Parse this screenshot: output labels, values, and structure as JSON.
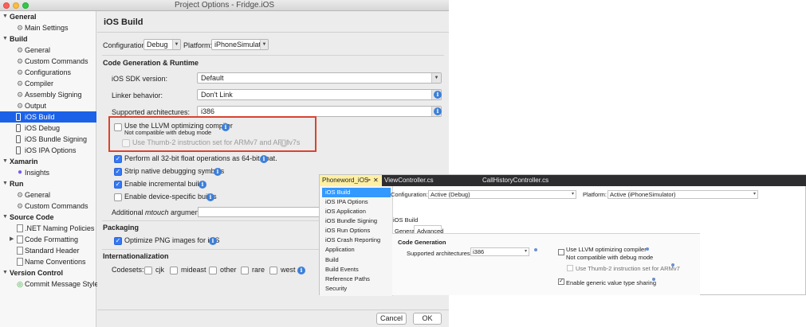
{
  "window": {
    "title": "Project Options - Fridge.iOS"
  },
  "sidebar": {
    "groups": [
      {
        "label": "General",
        "items": [
          {
            "label": "Main Settings",
            "icon": "gear-icon"
          }
        ]
      },
      {
        "label": "Build",
        "items": [
          {
            "label": "General",
            "icon": "gear-icon"
          },
          {
            "label": "Custom Commands",
            "icon": "gear-icon"
          },
          {
            "label": "Configurations",
            "icon": "gear-icon"
          },
          {
            "label": "Compiler",
            "icon": "gear-icon"
          },
          {
            "label": "Assembly Signing",
            "icon": "gear-icon"
          },
          {
            "label": "Output",
            "icon": "gear-icon"
          },
          {
            "label": "iOS Build",
            "icon": "phone-icon",
            "selected": true
          },
          {
            "label": "iOS Debug",
            "icon": "phone-icon"
          },
          {
            "label": "iOS Bundle Signing",
            "icon": "phone-icon"
          },
          {
            "label": "iOS IPA Options",
            "icon": "phone-icon"
          }
        ]
      },
      {
        "label": "Xamarin",
        "items": [
          {
            "label": "Insights",
            "icon": "bulb-icon"
          }
        ]
      },
      {
        "label": "Run",
        "items": [
          {
            "label": "General",
            "icon": "gear-icon"
          },
          {
            "label": "Custom Commands",
            "icon": "gear-icon"
          }
        ]
      },
      {
        "label": "Source Code",
        "items": [
          {
            "label": ".NET Naming Policies",
            "icon": "page-icon"
          },
          {
            "label": "Code Formatting",
            "icon": "page-icon"
          },
          {
            "label": "Standard Header",
            "icon": "page-icon"
          },
          {
            "label": "Name Conventions",
            "icon": "page-icon"
          }
        ]
      },
      {
        "label": "Version Control",
        "items": [
          {
            "label": "Commit Message Style",
            "icon": "circle-icon"
          }
        ]
      }
    ]
  },
  "main": {
    "title": "iOS Build",
    "configuration_label": "Configuration:",
    "configuration_value": "Debug",
    "platform_label": "Platform:",
    "platform_value": "iPhoneSimulator",
    "codegen_section": "Code Generation & Runtime",
    "sdk_label": "iOS SDK version:",
    "sdk_value": "Default",
    "linker_label": "Linker behavior:",
    "linker_value": "Don't Link",
    "arch_label": "Supported architectures:",
    "arch_value": "i386",
    "llvm_label": "Use the LLVM optimizing compiler",
    "llvm_note": "Not compatible with debug mode",
    "thumb_label": "Use Thumb-2 instruction set for ARMv7 and ARMv7s",
    "float_label": "Perform all 32-bit float operations as 64-bit float.",
    "strip_label": "Strip native debugging symbols",
    "incremental_label": "Enable incremental builds",
    "device_builds_label": "Enable device-specific builds",
    "mtouch_label_prefix": "Additional ",
    "mtouch_label_italic": "mtouch",
    "mtouch_label_suffix": " arguments:",
    "mtouch_value": "",
    "packaging_section": "Packaging",
    "png_label": "Optimize PNG images for iOS",
    "i18n_section": "Internationalization",
    "codesets_label": "Codesets:",
    "codesets": [
      "cjk",
      "mideast",
      "other",
      "rare",
      "west"
    ],
    "cancel_label": "Cancel",
    "ok_label": "OK"
  },
  "vs": {
    "tabs": [
      "Phoneword_iOS",
      "ViewController.cs",
      "CallHistoryController.cs"
    ],
    "nav_items": [
      "iOS Build",
      "iOS IPA Options",
      "iOS Application",
      "iOS Bundle Signing",
      "iOS Run Options",
      "iOS Crash Reporting",
      "Application",
      "Build",
      "Build Events",
      "Reference Paths",
      "Security"
    ],
    "configuration_label": "Configuration:",
    "configuration_value": "Active (Debug)",
    "platform_label": "Platform:",
    "platform_value": "Active (iPhoneSimulator)",
    "page_heading": "iOS Build",
    "subtab_general": "General",
    "subtab_advanced": "Advanced",
    "codegen_heading": "Code Generation",
    "arch_label": "Supported architectures:",
    "arch_value": "i386",
    "llvm_label": "Use LLVM optimizing compiler",
    "llvm_note": "Not compatible with debug mode",
    "thumb_label": "Use Thumb-2 instruction set for ARMv7",
    "generic_label": "Enable generic value type sharing"
  },
  "checks": {
    "llvm": false,
    "thumb": false,
    "float": true,
    "strip": true,
    "incremental": true,
    "device_builds": false,
    "png": true,
    "codesets": [
      false,
      false,
      false,
      false,
      false
    ],
    "vs_llvm": false,
    "vs_thumb": false,
    "vs_generic": true
  },
  "colors": {
    "selection": "#1c62e8",
    "highlight_box": "#d9432f",
    "info": "#3d7fd9",
    "checkbox_checked": "#3478f6"
  }
}
